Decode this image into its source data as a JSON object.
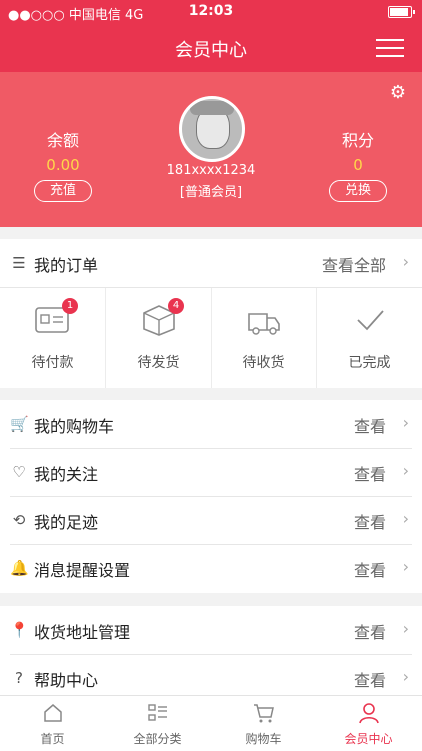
{
  "status_bar": {
    "carrier": "●●○○○ 中国电信 4G",
    "time": "12:03"
  },
  "header": {
    "title": "会员中心"
  },
  "profile": {
    "balance_label": "余额",
    "balance_value": "0.00",
    "recharge_label": "充值",
    "points_label": "积分",
    "points_value": "0",
    "exchange_label": "兑换",
    "phone": "181xxxx1234",
    "level": "[普通会员]"
  },
  "orders": {
    "title": "我的订单",
    "view_all": "查看全部",
    "statuses": [
      {
        "label": "待付款",
        "badge": "1"
      },
      {
        "label": "待发货",
        "badge": "4"
      },
      {
        "label": "待收货",
        "badge": ""
      },
      {
        "label": "已完成",
        "badge": ""
      }
    ]
  },
  "menu_group1": [
    {
      "label": "我的购物车",
      "action": "查看",
      "icon": "cart-icon"
    },
    {
      "label": "我的关注",
      "action": "查看",
      "icon": "heart-icon"
    },
    {
      "label": "我的足迹",
      "action": "查看",
      "icon": "footprint-icon"
    },
    {
      "label": "消息提醒设置",
      "action": "查看",
      "icon": "bell-icon"
    }
  ],
  "menu_group2": [
    {
      "label": "收货地址管理",
      "action": "查看",
      "icon": "location-icon"
    },
    {
      "label": "帮助中心",
      "action": "查看",
      "icon": "help-icon"
    }
  ],
  "tabbar": [
    {
      "label": "首页",
      "icon": "home-icon"
    },
    {
      "label": "全部分类",
      "icon": "category-icon"
    },
    {
      "label": "购物车",
      "icon": "cart-icon"
    },
    {
      "label": "会员中心",
      "icon": "user-icon",
      "active": true
    }
  ],
  "colors": {
    "brand": "#e9344f",
    "hero": "#f05a65",
    "accent_value": "#ffd74a"
  }
}
